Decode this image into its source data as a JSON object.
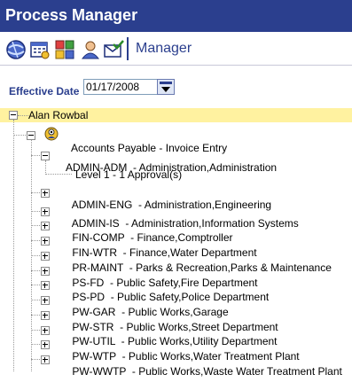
{
  "app": {
    "title": "Process Manager"
  },
  "toolbar": {
    "icons": [
      "globe-icon",
      "calendar-icon",
      "org-chart-icon",
      "user-process-icon",
      "envelope-check-icon"
    ],
    "label": "Manager"
  },
  "effective_date": {
    "label": "Effective Date",
    "value": "01/17/2008"
  },
  "colors": {
    "header": "#2b3f8e",
    "root_highlight": "#fff2a0"
  },
  "tree": {
    "root": "Alan Rowbal",
    "process": {
      "code": "Accounts Payable",
      "description": " - Invoice Entry"
    },
    "expanded_group": {
      "code": "ADMIN-ADM",
      "description": "  - Administration,Administration"
    },
    "level_item": "Level 1 - 1 Approval(s)",
    "groups": [
      {
        "code": "ADMIN-ENG",
        "description": "  - Administration,Engineering"
      },
      {
        "code": "ADMIN-IS",
        "description": "  - Administration,Information Systems"
      },
      {
        "code": "FIN-COMP",
        "description": "  - Finance,Comptroller"
      },
      {
        "code": "FIN-WTR",
        "description": "  - Finance,Water Department"
      },
      {
        "code": "PR-MAINT",
        "description": "  - Parks & Recreation,Parks & Maintenance"
      },
      {
        "code": "PS-FD",
        "description": "  - Public Safety,Fire Department"
      },
      {
        "code": "PS-PD",
        "description": "  - Public Safety,Police Department"
      },
      {
        "code": "PW-GAR",
        "description": "  - Public Works,Garage"
      },
      {
        "code": "PW-STR",
        "description": "  - Public Works,Street Department"
      },
      {
        "code": "PW-UTIL",
        "description": "  - Public Works,Utility Department"
      },
      {
        "code": "PW-WTP",
        "description": "  - Public Works,Water Treatment Plant"
      },
      {
        "code": "PW-WWTP",
        "description": "  - Public Works,Waste Water Treatment Plant"
      }
    ]
  }
}
